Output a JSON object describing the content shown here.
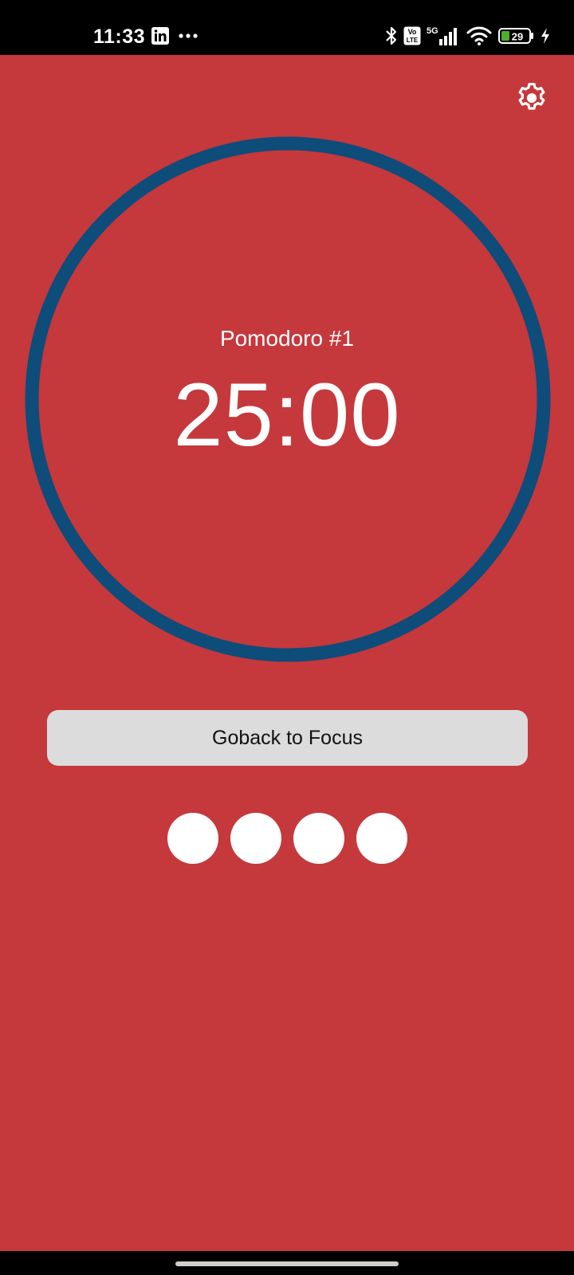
{
  "status_bar": {
    "time": "11:33",
    "left_icons": [
      "linkedin-icon",
      "more-dots-icon"
    ],
    "right_icons": [
      "bluetooth-icon",
      "volte-icon",
      "signal-5g-icon",
      "wifi-icon",
      "battery-icon",
      "charging-icon"
    ],
    "volte_label_top": "Vo",
    "volte_label_bottom": "LTE",
    "network_label": "5G",
    "battery_level": "29"
  },
  "colors": {
    "background": "#c5383c",
    "ring": "#0e4c7a",
    "text": "#ffffff",
    "button_bg": "#dcdcdc"
  },
  "timer": {
    "label": "Pomodoro #1",
    "time": "25:00"
  },
  "action_button": {
    "label": "Goback to Focus"
  },
  "session_dots": {
    "total": 4,
    "filled": 4
  },
  "icons": {
    "settings": "gear-icon"
  }
}
